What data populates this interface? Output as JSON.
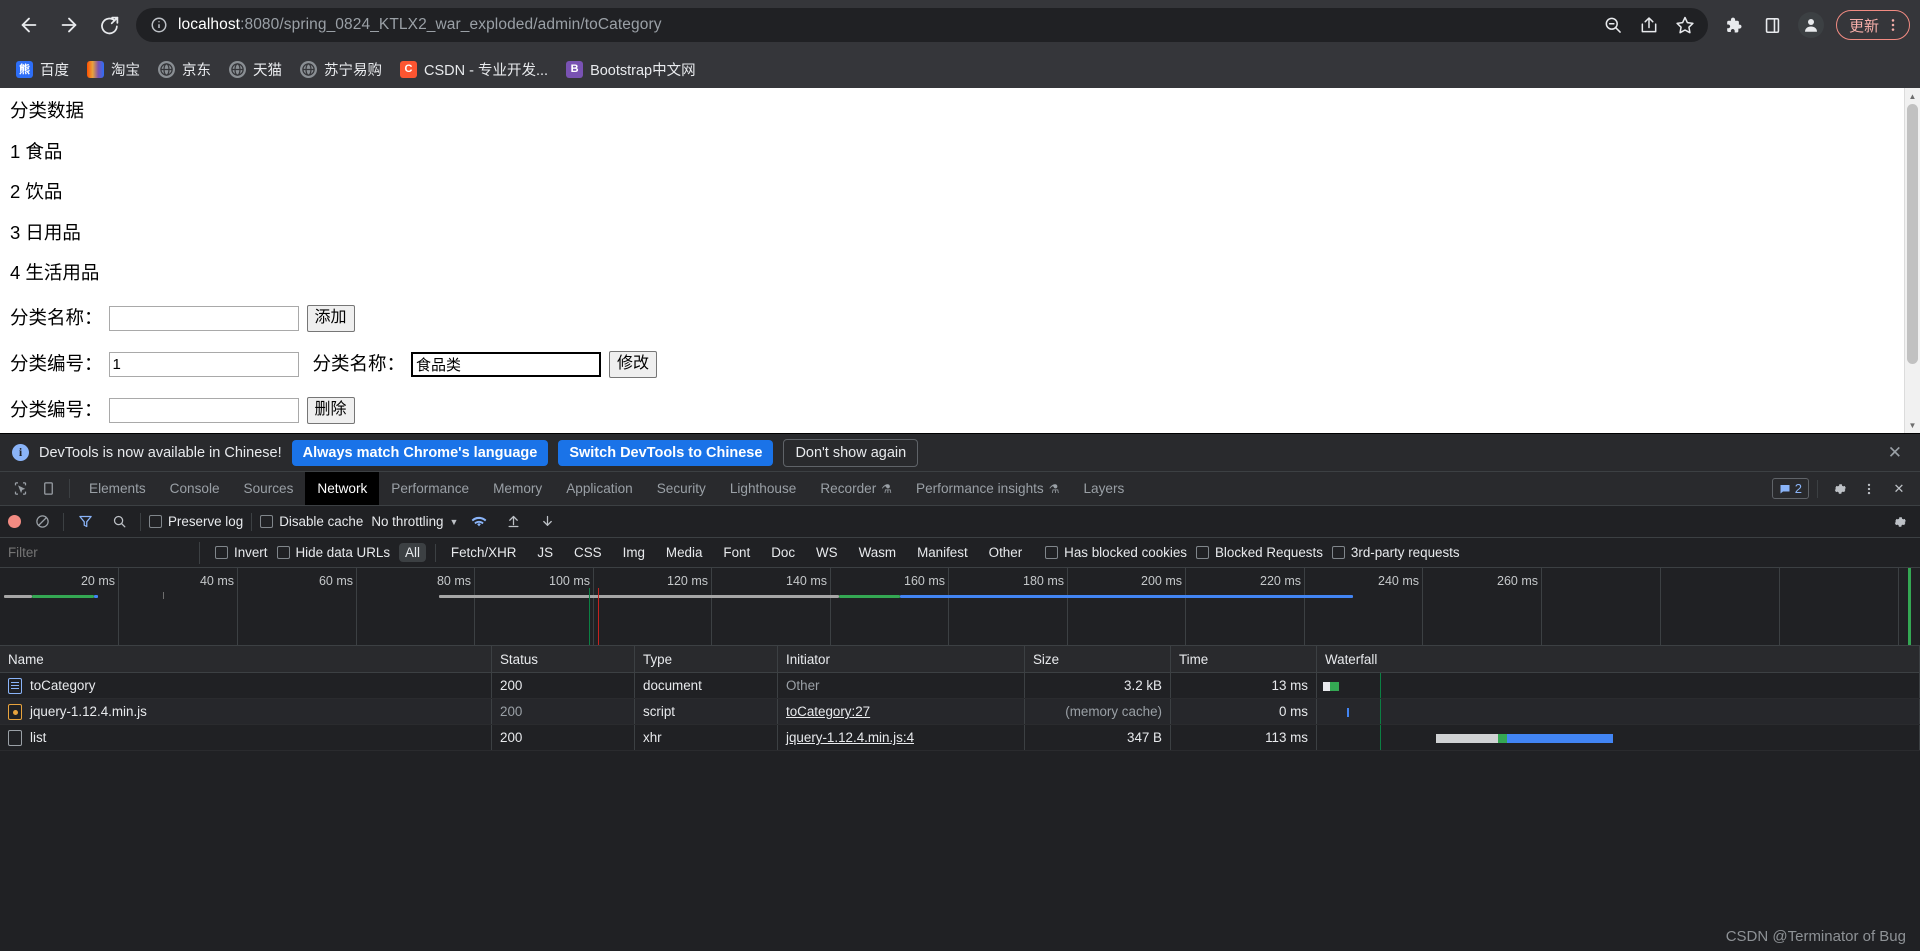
{
  "browser": {
    "nav": {
      "back": "back-arrow",
      "forward": "forward-arrow",
      "reload": "reload"
    },
    "url": {
      "host": "localhost",
      "path": ":8080/spring_0824_KTLX2_war_exploded/admin/toCategory",
      "full": "localhost:8080/spring_0824_KTLX2_war_exploded/admin/toCategory"
    },
    "omnibox_actions": [
      "search-icon",
      "share-icon",
      "bookmark-star-icon"
    ],
    "toolbar_actions": [
      "extensions-puzzle-icon",
      "side-panel-icon",
      "profile-avatar"
    ],
    "update_button": "更新",
    "bookmarks": [
      {
        "label": "百度",
        "icon": "baidu-icon",
        "color": "#2d6ef7"
      },
      {
        "label": "淘宝",
        "icon": "taobao-icon",
        "color": "#ff5000"
      },
      {
        "label": "京东",
        "icon": "globe-icon",
        "color": "#8a8f94"
      },
      {
        "label": "天猫",
        "icon": "globe-icon",
        "color": "#8a8f94"
      },
      {
        "label": "苏宁易购",
        "icon": "globe-icon",
        "color": "#8a8f94"
      },
      {
        "label": "CSDN - 专业开发...",
        "icon": "csdn-icon",
        "color": "#fc5531",
        "letter": "C"
      },
      {
        "label": "Bootstrap中文网",
        "icon": "bootstrap-icon",
        "color": "#7952b3",
        "letter": "B"
      }
    ]
  },
  "page": {
    "heading": "分类数据",
    "categories": [
      "1 食品",
      "2 饮品",
      "3 日用品",
      "4 生活用品"
    ],
    "add_form": {
      "label": "分类名称：",
      "value": "",
      "button": "添加"
    },
    "edit_form": {
      "id_label": "分类编号：",
      "id_value": "1",
      "name_label": "分类名称：",
      "name_value": "食品类",
      "button": "修改"
    },
    "delete_form": {
      "id_label": "分类编号：",
      "id_value": "",
      "button": "删除"
    }
  },
  "devtools": {
    "banner": {
      "message": "DevTools is now available in Chinese!",
      "primary": "Always match Chrome's language",
      "secondary": "Switch DevTools to Chinese",
      "dismiss": "Don't show again",
      "close": "close-icon"
    },
    "tabs": [
      {
        "label": "Elements",
        "active": false,
        "flask": false
      },
      {
        "label": "Console",
        "active": false,
        "flask": false
      },
      {
        "label": "Sources",
        "active": false,
        "flask": false
      },
      {
        "label": "Network",
        "active": true,
        "flask": false
      },
      {
        "label": "Performance",
        "active": false,
        "flask": false
      },
      {
        "label": "Memory",
        "active": false,
        "flask": false
      },
      {
        "label": "Application",
        "active": false,
        "flask": false
      },
      {
        "label": "Security",
        "active": false,
        "flask": false
      },
      {
        "label": "Lighthouse",
        "active": false,
        "flask": false
      },
      {
        "label": "Recorder",
        "active": false,
        "flask": true
      },
      {
        "label": "Performance insights",
        "active": false,
        "flask": true
      },
      {
        "label": "Layers",
        "active": false,
        "flask": false
      }
    ],
    "message_count": "2",
    "network_toolbar": {
      "record": "record-button",
      "clear": "clear-button",
      "filter": "filter-icon",
      "search": "search-icon",
      "preserve_log": "Preserve log",
      "disable_cache": "Disable cache",
      "throttling": "No throttling",
      "import": "import-har-icon",
      "export": "export-har-icon",
      "settings": "settings-gear-icon"
    },
    "filter_bar": {
      "placeholder": "Filter",
      "value": "",
      "invert": "Invert",
      "hide_data_urls": "Hide data URLs",
      "types": [
        "All",
        "Fetch/XHR",
        "JS",
        "CSS",
        "Img",
        "Media",
        "Font",
        "Doc",
        "WS",
        "Wasm",
        "Manifest",
        "Other"
      ],
      "selected_type": "All",
      "has_blocked_cookies": "Has blocked cookies",
      "blocked_requests": "Blocked Requests",
      "third_party": "3rd-party requests"
    },
    "timeline_ticks": [
      "20 ms",
      "40 ms",
      "60 ms",
      "80 ms",
      "100 ms",
      "120 ms",
      "140 ms",
      "160 ms",
      "180 ms",
      "200 ms",
      "220 ms",
      "240 ms",
      "260 ms"
    ],
    "table": {
      "columns": [
        "Name",
        "Status",
        "Type",
        "Initiator",
        "Size",
        "Time",
        "Waterfall"
      ],
      "rows": [
        {
          "name": "toCategory",
          "icon": "document-icon",
          "status": "200",
          "type": "document",
          "initiator": "Other",
          "initiator_link": false,
          "size": "3.2 kB",
          "time": "13 ms"
        },
        {
          "name": "jquery-1.12.4.min.js",
          "icon": "script-icon",
          "status": "200",
          "type": "script",
          "initiator": "toCategory:27",
          "initiator_link": true,
          "size": "(memory cache)",
          "time": "0 ms"
        },
        {
          "name": "list",
          "icon": "xhr-icon",
          "status": "200",
          "type": "xhr",
          "initiator": "jquery-1.12.4.min.js:4",
          "initiator_link": true,
          "size": "347 B",
          "time": "113 ms"
        }
      ]
    },
    "watermark": "CSDN @Terminator of Bug"
  }
}
